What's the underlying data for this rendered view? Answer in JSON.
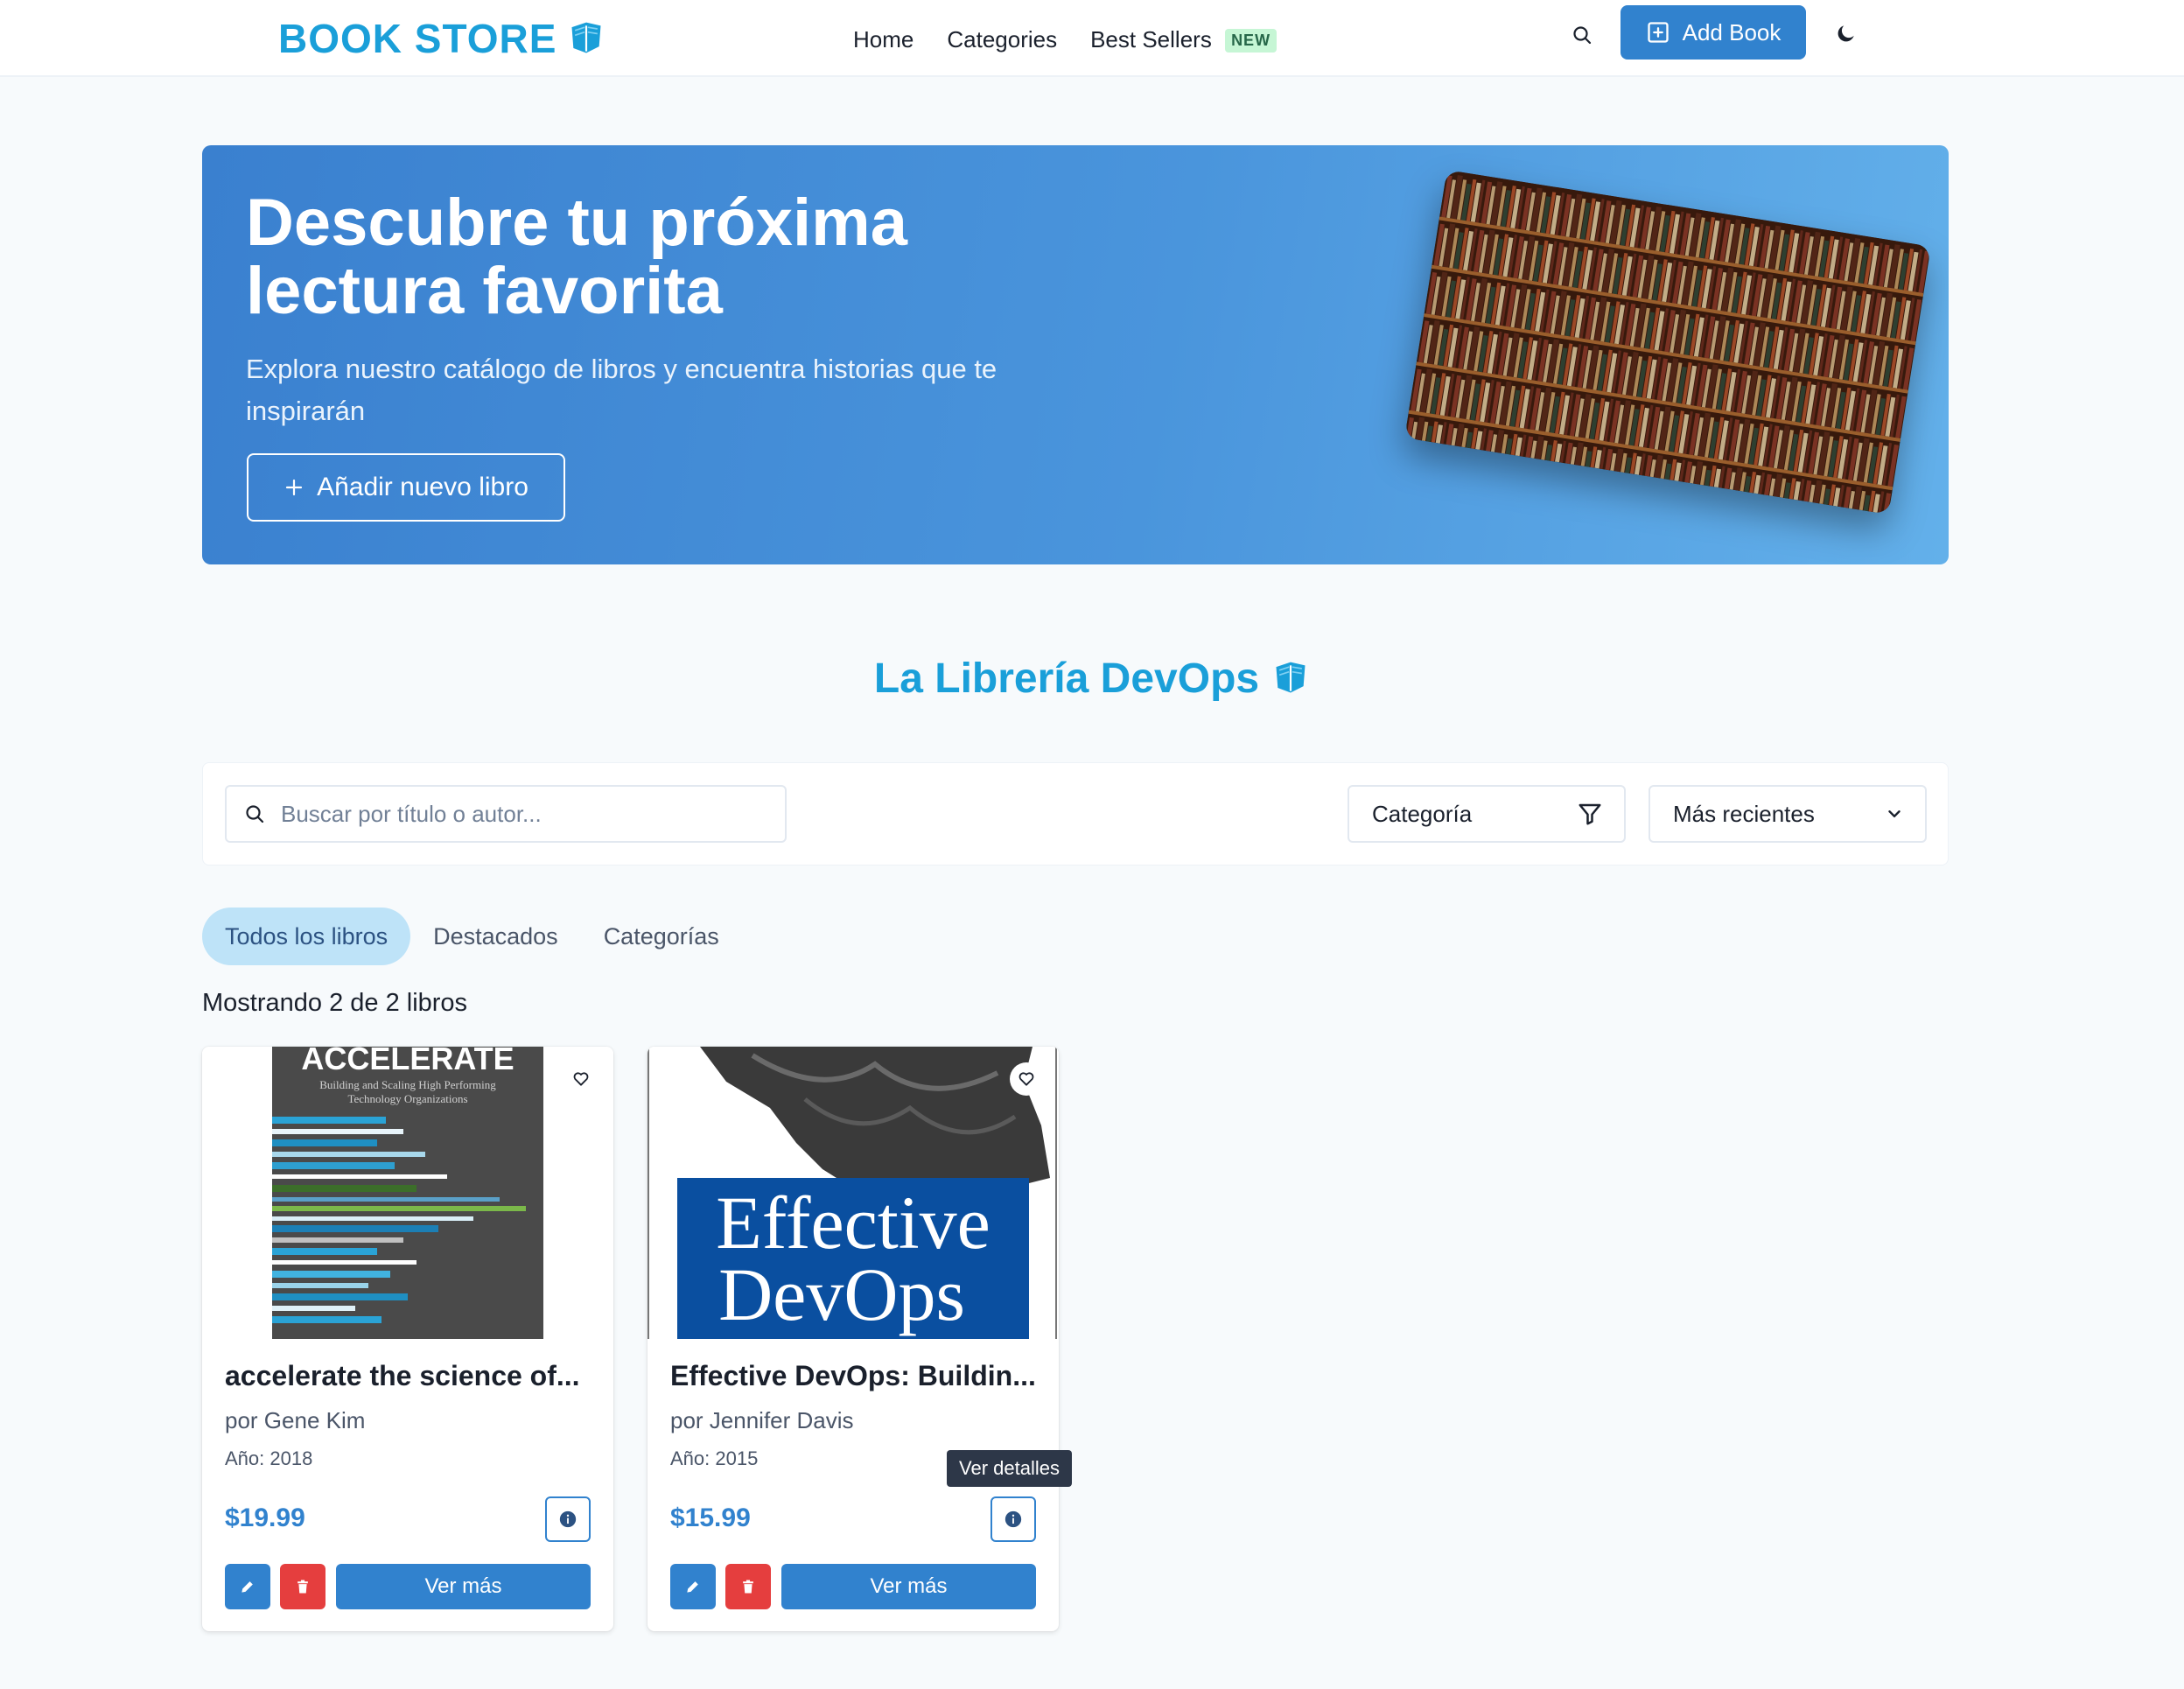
{
  "nav": {
    "brand": "BOOK STORE",
    "links": [
      "Home",
      "Categories",
      "Best Sellers"
    ],
    "new_badge": "NEW",
    "add_book_label": "Add Book"
  },
  "hero": {
    "title_line1": "Descubre tu próxima",
    "title_line2": "lectura favorita",
    "subtitle": "Explora nuestro catálogo de libros y encuentra historias que te inspirarán",
    "button_label": "Añadir nuevo libro"
  },
  "section": {
    "title": "La Librería DevOps"
  },
  "filters": {
    "search_placeholder": "Buscar por título o autor...",
    "category_label": "Categoría",
    "sort_label": "Más recientes"
  },
  "tabs": [
    "Todos los libros",
    "Destacados",
    "Categorías"
  ],
  "active_tab": "Todos los libros",
  "count_text": "Mostrando 2 de 2 libros",
  "books": [
    {
      "title": "accelerate the science of...",
      "author": "por Gene Kim",
      "year": "Año: 2018",
      "price": "$19.99",
      "cover_title": "ACCELERATE",
      "cover_subtitle_1": "Building and Scaling High Performing",
      "cover_subtitle_2": "Technology Organizations"
    },
    {
      "title": "Effective DevOps: Buildin...",
      "author": "por Jennifer Davis",
      "year": "Año: 2015",
      "price": "$15.99",
      "cover_title_1": "Effective",
      "cover_title_2": "DevOps"
    }
  ],
  "card_more_label": "Ver más",
  "tooltip": "Ver detalles",
  "colors": {
    "brand": "#1a9fd9",
    "primary": "#3182ce",
    "danger": "#e53e3e",
    "tab_active_bg": "#bee3f8"
  },
  "icons": [
    "book-icon",
    "search-icon",
    "plus-square-icon",
    "moon-icon",
    "plus-icon",
    "filter-icon",
    "chevron-down-icon",
    "heart-icon",
    "info-icon",
    "pencil-icon",
    "trash-icon"
  ]
}
